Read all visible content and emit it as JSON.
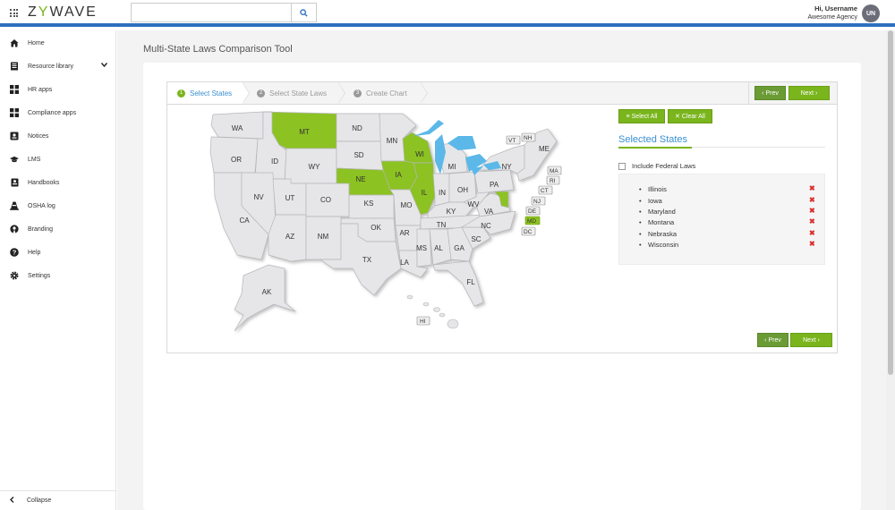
{
  "app": {
    "logo": "ZYWAVE"
  },
  "search": {
    "placeholder": ""
  },
  "user": {
    "greeting": "Hi, Username",
    "agency": "Awesome Agency",
    "initials": "UN"
  },
  "sidebar": {
    "items": [
      {
        "label": "Home",
        "icon": "home-icon"
      },
      {
        "label": "Resource library",
        "icon": "library-icon"
      },
      {
        "label": "HR apps",
        "icon": "apps-icon"
      },
      {
        "label": "Compliance apps",
        "icon": "apps-icon"
      },
      {
        "label": "Notices",
        "icon": "notices-icon"
      },
      {
        "label": "LMS",
        "icon": "graduation-cap-icon"
      },
      {
        "label": "Handbooks",
        "icon": "handbook-icon"
      },
      {
        "label": "OSHA log",
        "icon": "cone-icon"
      },
      {
        "label": "Branding",
        "icon": "branding-icon"
      },
      {
        "label": "Help",
        "icon": "help-icon"
      },
      {
        "label": "Settings",
        "icon": "gear-icon"
      }
    ],
    "collapse_label": "Collapse"
  },
  "page": {
    "title": "Multi-State Laws Comparison Tool"
  },
  "wizard": {
    "steps": [
      {
        "num": "1",
        "label": "Select States"
      },
      {
        "num": "2",
        "label": "Select State Laws"
      },
      {
        "num": "3",
        "label": "Create Chart"
      }
    ],
    "prev_label": "Prev",
    "next_label": "Next",
    "select_all_label": "Select All",
    "clear_all_label": "Clear All"
  },
  "selected": {
    "title": "Selected States",
    "federal_label": "Include Federal Laws",
    "states": [
      "Illinois",
      "Iowa",
      "Maryland",
      "Montana",
      "Nebraska",
      "Wisconsin"
    ]
  },
  "map": {
    "labels": {
      "WA": "WA",
      "MT": "MT",
      "ND": "ND",
      "MN": "MN",
      "OR": "OR",
      "ID": "ID",
      "WY": "WY",
      "SD": "SD",
      "WI": "WI",
      "MI": "MI",
      "NE": "NE",
      "IA": "IA",
      "NV": "NV",
      "UT": "UT",
      "CO": "CO",
      "KS": "KS",
      "MO": "MO",
      "IL": "IL",
      "IN": "IN",
      "OH": "OH",
      "PA": "PA",
      "NY": "NY",
      "CA": "CA",
      "AZ": "AZ",
      "NM": "NM",
      "OK": "OK",
      "AR": "AR",
      "TN": "TN",
      "KY": "KY",
      "WV": "WV",
      "VA": "VA",
      "NC": "NC",
      "TX": "TX",
      "LA": "LA",
      "MS": "MS",
      "AL": "AL",
      "GA": "GA",
      "SC": "SC",
      "FL": "FL",
      "AK": "AK",
      "HI": "HI",
      "ME": "ME",
      "VT": "VT",
      "NH": "NH",
      "MA": "MA",
      "RI": "RI",
      "CT": "CT",
      "NJ": "NJ",
      "DE": "DE",
      "MD": "MD",
      "DC": "DC"
    }
  },
  "colors": {
    "accent": "#7ab51d",
    "link": "#3a8fd0",
    "brand_bar": "#2d6fbf",
    "selected_state": "#8cc220",
    "state": "#e6e6e8",
    "lakes": "#5bb8e8",
    "remove": "#d9302c"
  }
}
